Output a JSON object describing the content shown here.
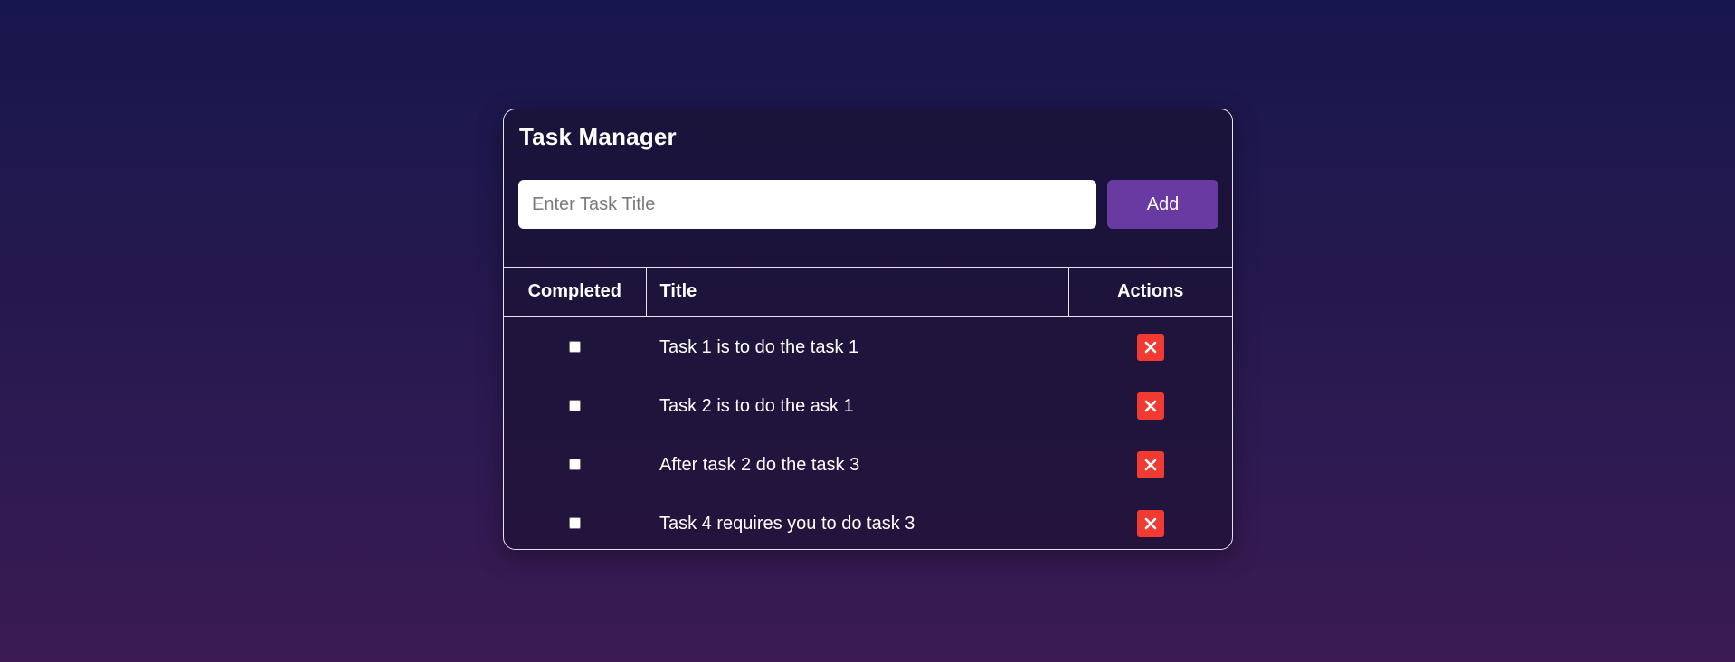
{
  "app": {
    "title": "Task Manager"
  },
  "form": {
    "input_value": "",
    "input_placeholder": "Enter Task Title",
    "add_label": "Add"
  },
  "table": {
    "headers": {
      "completed": "Completed",
      "title": "Title",
      "actions": "Actions"
    },
    "rows": [
      {
        "completed": false,
        "title": "Task 1 is to do the task 1",
        "action_icon": "close-icon"
      },
      {
        "completed": false,
        "title": "Task 2 is to do the ask 1",
        "action_icon": "close-icon"
      },
      {
        "completed": false,
        "title": "After task 2 do the task 3",
        "action_icon": "close-icon"
      },
      {
        "completed": false,
        "title": "Task 4 requires you to do task 3",
        "action_icon": "close-icon"
      }
    ]
  },
  "colors": {
    "accent": "#6a3aa3",
    "danger": "#f03a32",
    "border": "#e6e2f0",
    "background_top": "#18174d",
    "background_bottom": "#3b1a52"
  }
}
